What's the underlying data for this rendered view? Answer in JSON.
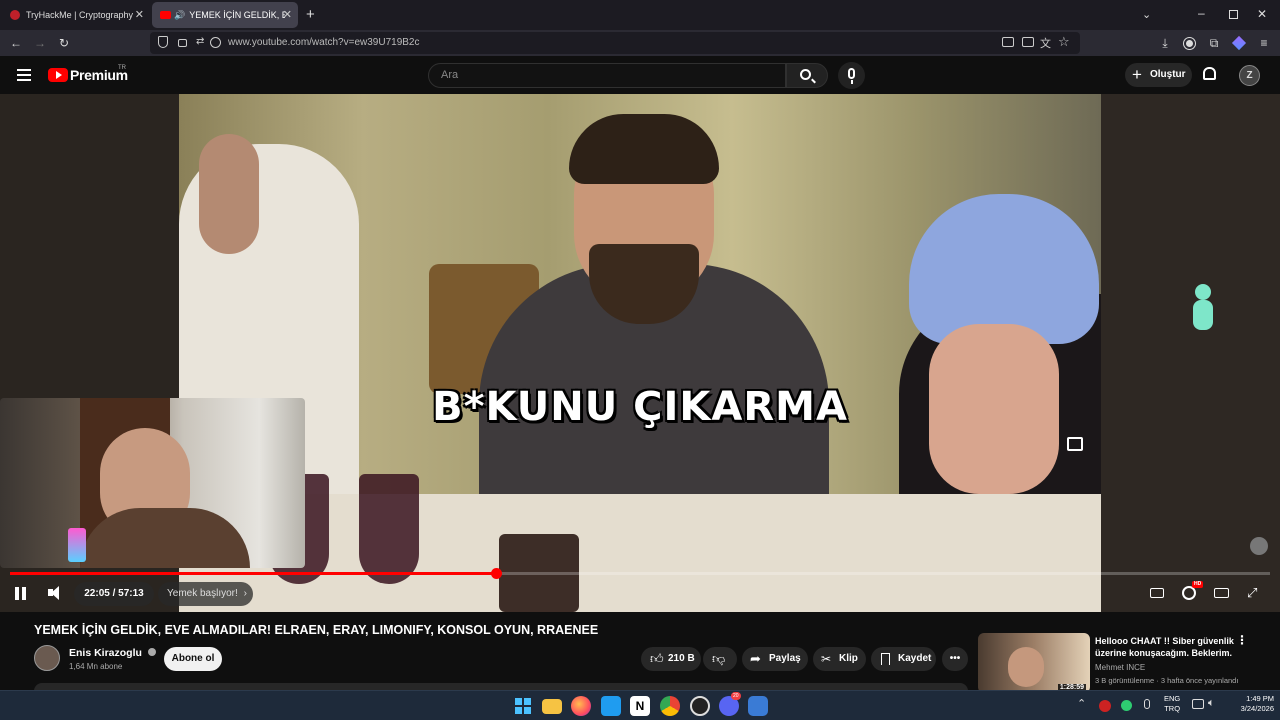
{
  "browser": {
    "tabs": [
      {
        "label": "TryHackMe | Cryptography Conc",
        "active": false
      },
      {
        "label": "YEMEK İÇİN GELDİK, EVE AL",
        "active": true
      }
    ],
    "url": "www.youtube.com/watch?v=ew39U719B2c"
  },
  "youtube": {
    "logo_text": "Premium",
    "region_badge": "TR",
    "search_placeholder": "Ara",
    "create_label": "Oluştur",
    "avatar_letter": "Z"
  },
  "player": {
    "subtitle": "B*KUNU ÇIKARMA",
    "time_current": "22:05",
    "time_separator": "/",
    "time_total": "57:13",
    "chapter_label": "Yemek başlıyor!",
    "progress_fraction": 0.386,
    "settings_badge": "HD"
  },
  "video": {
    "title": "YEMEK İÇİN GELDİK, EVE ALMADILAR! ELRAEN, ERAY, LIMONIFY, KONSOL OYUN, RRAENEE",
    "channel_name": "Enis Kirazoglu",
    "subscribers": "1,64 Mn abone",
    "subscribe_label": "Abone ol",
    "likes": "210 B",
    "share_label": "Paylaş",
    "clip_label": "Klip",
    "save_label": "Kaydet"
  },
  "recommended": {
    "title_line1": "Hellooo CHAAT !! Siber güvenlik",
    "title_line2": "üzerine konuşacağım. Beklerim.",
    "channel": "Mehmet INCE",
    "meta": "3 B görüntülenme · 3 hafta önce yayınlandı",
    "duration": "1:28:59"
  },
  "taskbar": {
    "lang_line1": "ENG",
    "lang_line2": "TRQ",
    "time": "1:49 PM",
    "date": "3/24/2026",
    "discord_badge": "20"
  },
  "colors": {
    "accent_red": "#ff0000",
    "bg": "#0f0f0f",
    "pill": "#272727"
  }
}
